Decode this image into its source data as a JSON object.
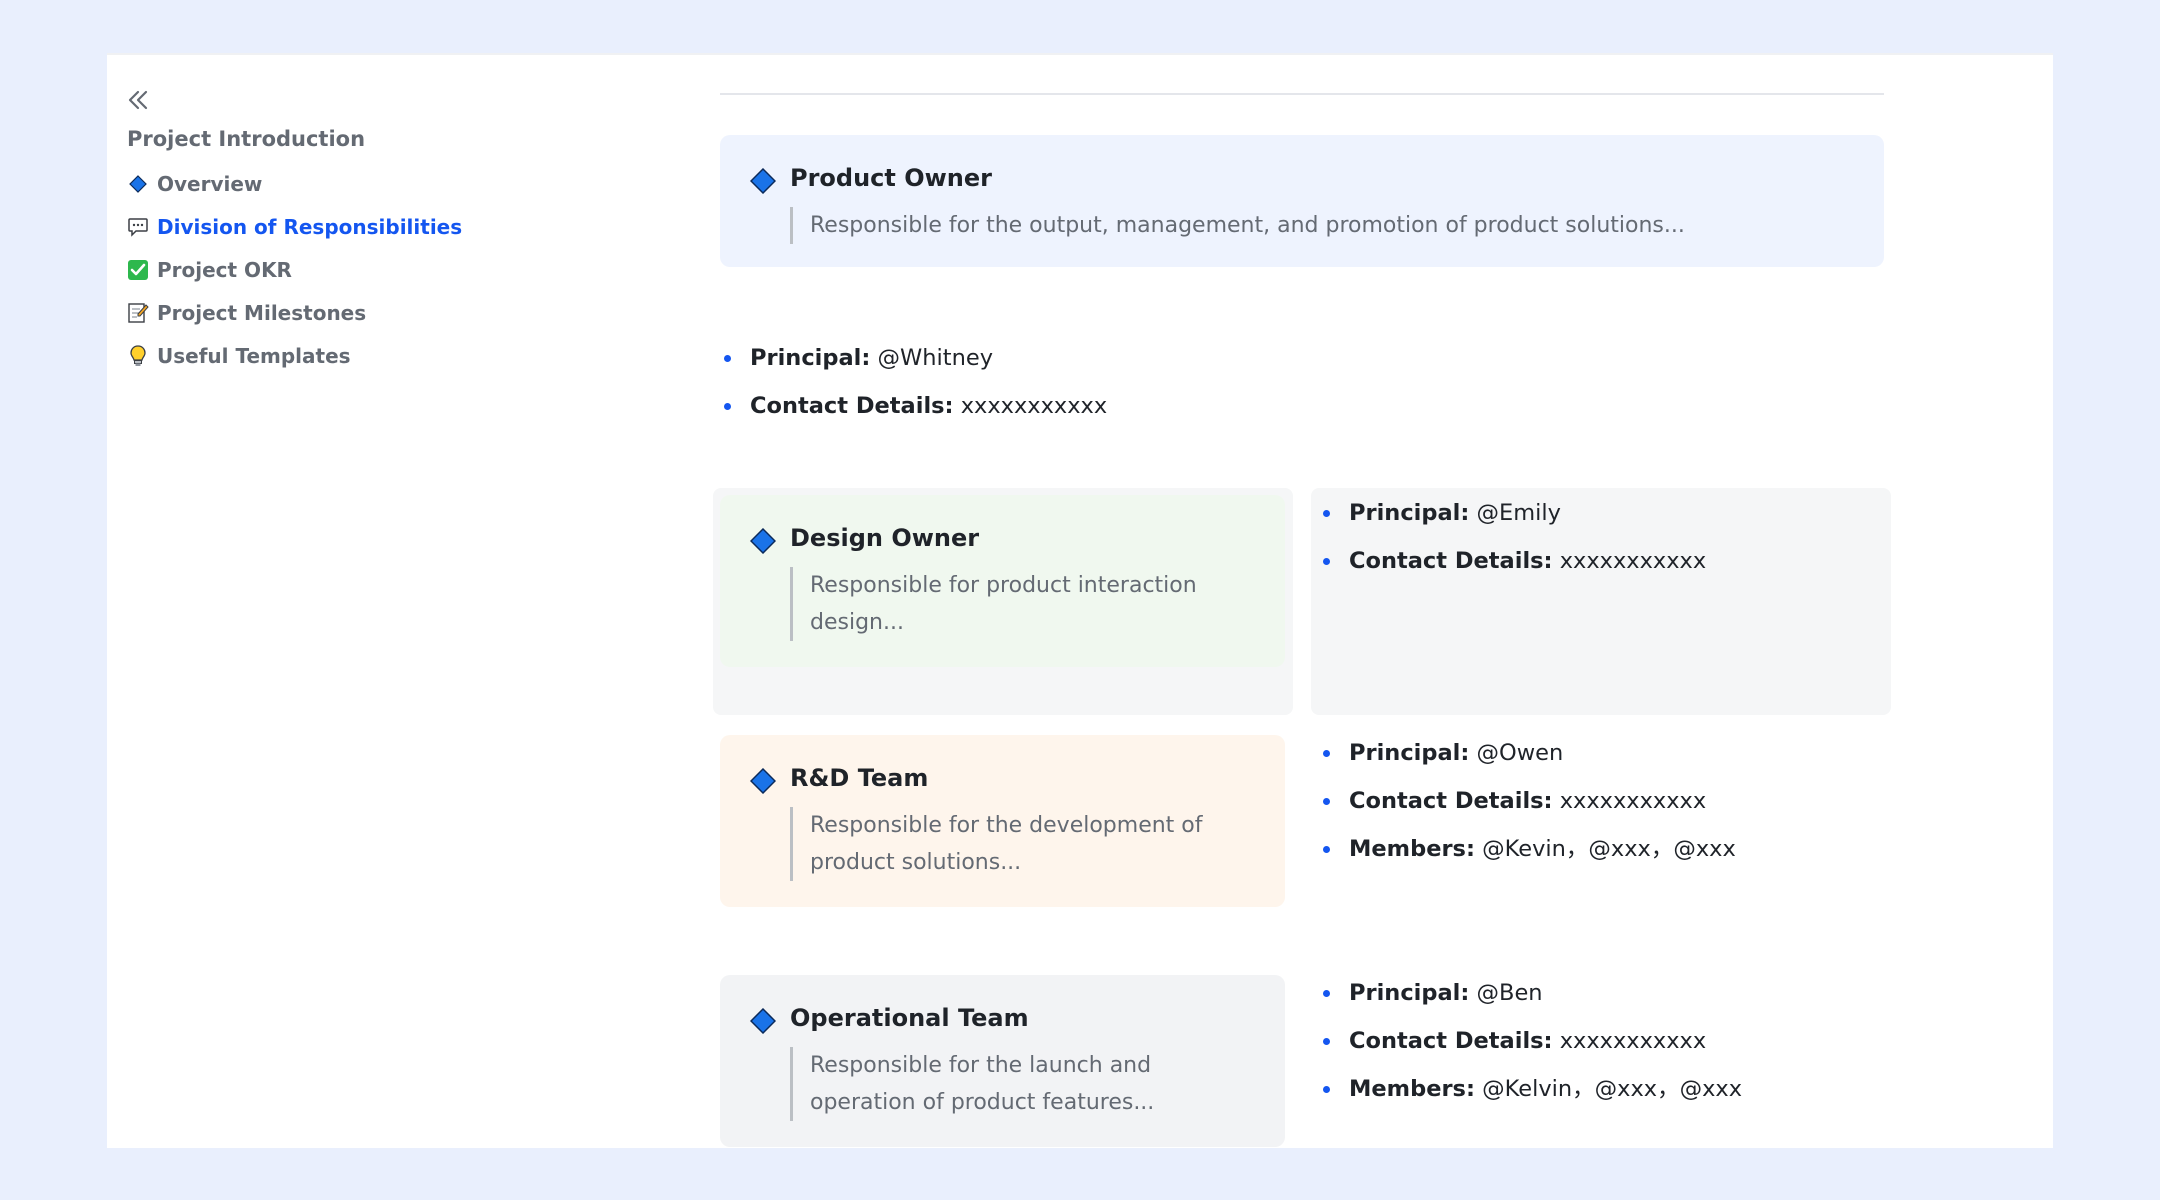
{
  "sidebar": {
    "collapse_icon": "double-chevron-left-icon",
    "title": "Project Introduction",
    "items": [
      {
        "label": "Overview",
        "icon": "blue-diamond-icon"
      },
      {
        "label": "Division of Responsibilities",
        "icon": "speech-bubble-icon",
        "active": true
      },
      {
        "label": "Project OKR",
        "icon": "check-box-icon"
      },
      {
        "label": "Project Milestones",
        "icon": "memo-icon"
      },
      {
        "label": "Useful Templates",
        "icon": "light-bulb-icon"
      }
    ]
  },
  "product_owner": {
    "title": "Product Owner",
    "description": "Responsible for the output, management, and promotion of product solutions...",
    "principal_label": "Principal:",
    "principal": "@Whitney",
    "contact_label": "Contact Details:",
    "contact": "xxxxxxxxxxx"
  },
  "design_owner": {
    "title": "Design Owner",
    "description": "Responsible for product interaction design...",
    "principal_label": "Principal:",
    "principal": "@Emily",
    "contact_label": "Contact Details:",
    "contact": "xxxxxxxxxxx"
  },
  "rd_team": {
    "title": "R&D Team",
    "description": "Responsible for the development of product solutions...",
    "principal_label": "Principal:",
    "principal": "@Owen",
    "contact_label": "Contact Details:",
    "contact": "xxxxxxxxxxx",
    "members_label": "Members:",
    "members": "@Kevin，@xxx，@xxx"
  },
  "operational_team": {
    "title": "Operational Team",
    "description": "Responsible for the launch and operation of product features...",
    "principal_label": "Principal:",
    "principal": "@Ben",
    "contact_label": "Contact Details:",
    "contact": "xxxxxxxxxxx",
    "members_label": "Members:",
    "members": "@Kelvin，@xxx，@xxx"
  },
  "colors": {
    "accent": "#1456f0",
    "diamond": "#1a73e8",
    "product_owner_bg": "#eef3fe",
    "design_owner_bg": "#f0f8ef",
    "rd_team_bg": "#fef5ec",
    "operational_team_bg": "#f2f3f5",
    "panel_grey": "#f5f6f7"
  }
}
